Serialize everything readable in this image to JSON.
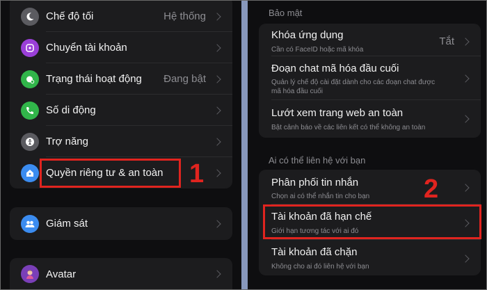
{
  "left": {
    "rows": [
      {
        "label": "Chế độ tối",
        "value": "Hệ thống",
        "icon": "moon-icon",
        "icon_bg": "#5b5b60"
      },
      {
        "label": "Chuyển tài khoản",
        "value": "",
        "icon": "switch-account-icon",
        "icon_bg": "#9a3fd8"
      },
      {
        "label": "Trạng thái hoạt động",
        "value": "Đang bật",
        "icon": "active-status-icon",
        "icon_bg": "#31b54a"
      },
      {
        "label": "Số di động",
        "value": "",
        "icon": "phone-icon",
        "icon_bg": "#31b54a"
      },
      {
        "label": "Trợ năng",
        "value": "",
        "icon": "accessibility-icon",
        "icon_bg": "#5b5b60"
      },
      {
        "label": "Quyền riêng tư & an toàn",
        "value": "",
        "icon": "privacy-home-icon",
        "icon_bg": "#3b8cf0"
      }
    ],
    "supervision": {
      "label": "Giám sát",
      "icon": "people-icon",
      "icon_bg": "#3b8cf0"
    },
    "avatar": {
      "label": "Avatar",
      "icon": "avatar-icon",
      "icon_bg": "#7a3fb8"
    }
  },
  "right": {
    "security_header": "Bảo mật",
    "security_rows": [
      {
        "title": "Khóa ứng dụng",
        "sub": "Cần có FaceID hoặc mã khóa",
        "value": "Tắt"
      },
      {
        "title": "Đoạn chat mã hóa đầu cuối",
        "sub": "Quản lý chế độ cài đặt dành cho các đoạn chat được mã hóa đầu cuối",
        "value": ""
      },
      {
        "title": "Lướt xem trang web an toàn",
        "sub": "Bật cảnh báo về các liên kết có thể không an toàn",
        "value": ""
      }
    ],
    "contact_header": "Ai có thể liên hệ với bạn",
    "contact_rows": [
      {
        "title": "Phân phối tin nhắn",
        "sub": "Chọn ai có thể nhắn tin cho bạn"
      },
      {
        "title": "Tài khoản đã hạn chế",
        "sub": "Giới hạn tương tác với ai đó"
      },
      {
        "title": "Tài khoản đã chặn",
        "sub": "Không cho ai đó liên hệ với bạn"
      }
    ]
  },
  "annotations": {
    "step1": "1",
    "step2": "2",
    "highlight_color": "#e0241f"
  }
}
